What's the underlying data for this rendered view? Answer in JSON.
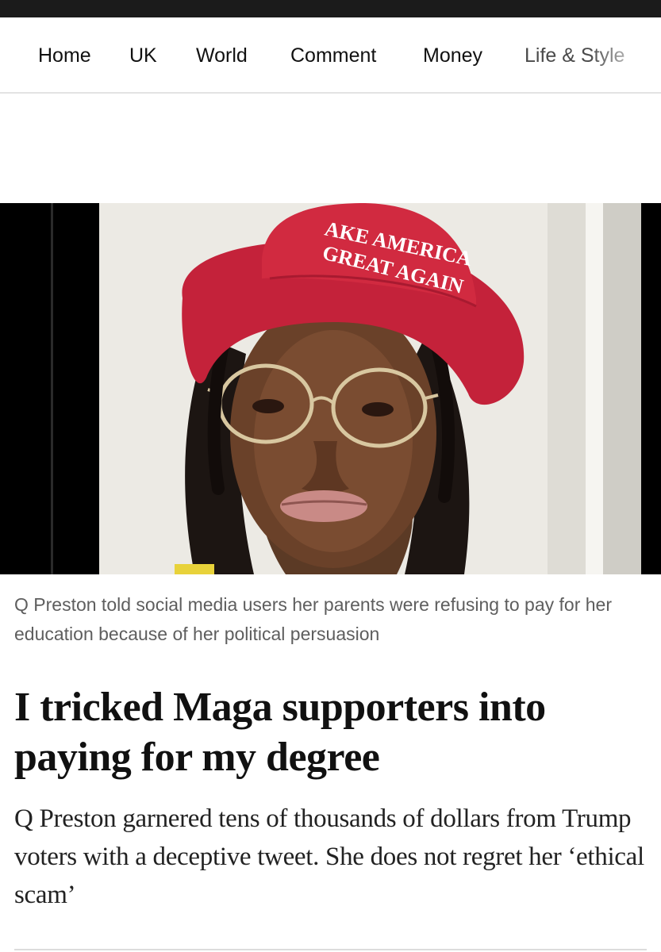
{
  "nav": {
    "items": [
      "Home",
      "UK",
      "World",
      "Comment",
      "Money",
      "Life & Style"
    ]
  },
  "photo": {
    "alt": "Q Preston",
    "hat_text_line1": "AKE AMERICA",
    "hat_text_line2": "GREAT AGAIN",
    "colors": {
      "hat": "#c8243a",
      "background": "#ecebe6",
      "frame": "#000000"
    }
  },
  "article": {
    "caption": "Q Preston told social media users her parents were refusing to pay for her education because of her political persuasion",
    "headline": "I tricked Maga supporters into paying for my degree",
    "standfirst": "Q Preston garnered tens of thousands of dollars from Trump voters with a deceptive tweet. She does not regret her ‘ethical scam’"
  }
}
